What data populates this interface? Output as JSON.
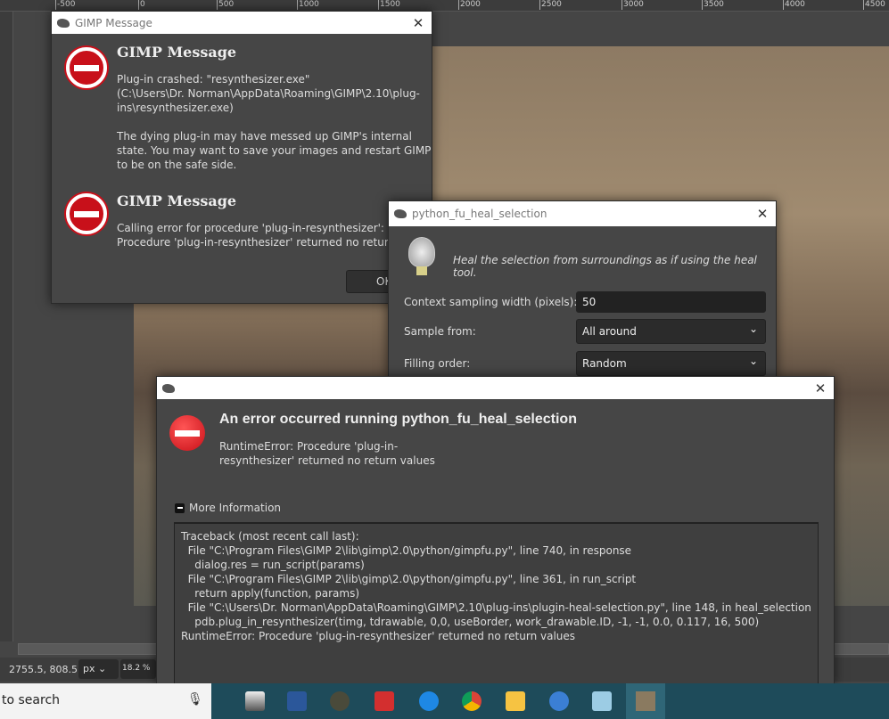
{
  "ruler": {
    "ticks": [
      "-500",
      "0",
      "500",
      "1000",
      "1500",
      "2000",
      "2500",
      "3000",
      "3500",
      "4000",
      "4500"
    ]
  },
  "status": {
    "coords": "2755.5, 808.5",
    "unit": "px",
    "zoom": "18.2 %"
  },
  "gimp_message": {
    "title": "GIMP Message",
    "messages": [
      {
        "heading": "GIMP Message",
        "lines": [
          "Plug-in crashed: \"resynthesizer.exe\"",
          "(C:\\Users\\Dr. Norman\\AppData\\Roaming\\GIMP\\2.10\\plug-",
          "ins\\resynthesizer.exe)",
          "",
          "The dying plug-in may have messed up GIMP's internal",
          "state. You may want to save your images and restart GIMP",
          "to be on the safe side."
        ]
      },
      {
        "heading": "GIMP Message",
        "lines": [
          "Calling error for procedure 'plug-in-resynthesizer':",
          "Procedure 'plug-in-resynthesizer' returned no return values"
        ]
      }
    ],
    "ok_label": "OK"
  },
  "heal_dialog": {
    "title": "python_fu_heal_selection",
    "description": "Heal the selection from surroundings as if using the heal tool.",
    "context_label": "Context sampling width (pixels):",
    "context_value": "50",
    "sample_label": "Sample from:",
    "sample_value": "All around",
    "order_label": "Filling order:",
    "order_value": "Random"
  },
  "error_dialog": {
    "heading": "An error occurred running python_fu_heal_selection",
    "message_line1": "RuntimeError: Procedure 'plug-in-",
    "message_line2": "resynthesizer' returned no return values",
    "more_info": "More Information",
    "traceback": "Traceback (most recent call last):\n  File \"C:\\Program Files\\GIMP 2\\lib\\gimp\\2.0\\python/gimpfu.py\", line 740, in response\n    dialog.res = run_script(params)\n  File \"C:\\Program Files\\GIMP 2\\lib\\gimp\\2.0\\python/gimpfu.py\", line 361, in run_script\n    return apply(function, params)\n  File \"C:\\Users\\Dr. Norman\\AppData\\Roaming\\GIMP\\2.10\\plug-ins\\plugin-heal-selection.py\", line 148, in heal_selection\n    pdb.plug_in_resynthesizer(timg, tdrawable, 0,0, useBorder, work_drawable.ID, -1, -1, 0.0, 0.117, 16, 500)\nRuntimeError: Procedure 'plug-in-resynthesizer' returned no return values"
  },
  "taskbar": {
    "search_text": "to search",
    "apps": [
      "scanner",
      "word",
      "gimp",
      "adobe",
      "edge",
      "chrome",
      "file-explorer",
      "thunderbird",
      "notepad",
      "photo-app"
    ]
  }
}
